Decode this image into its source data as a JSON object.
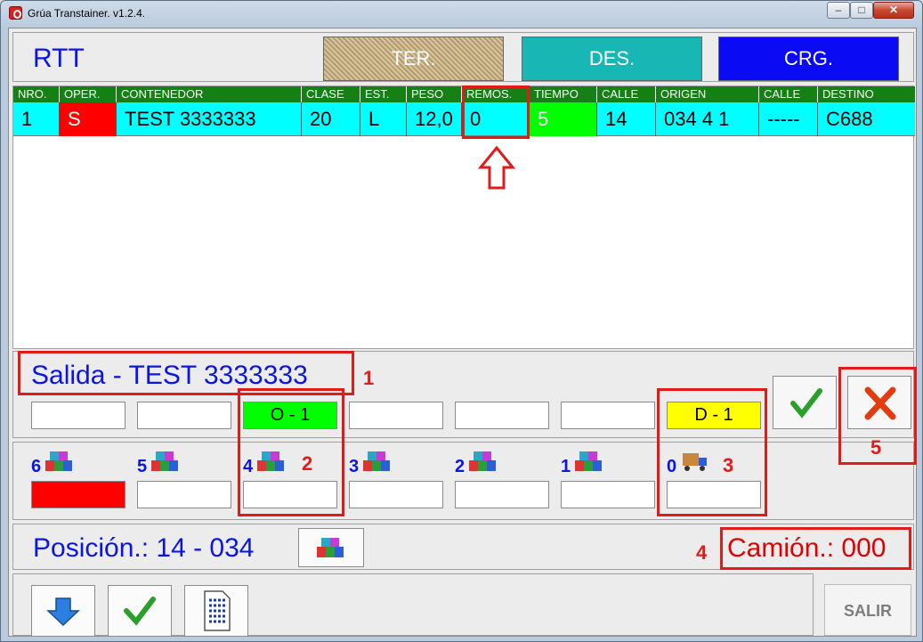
{
  "window": {
    "title": "Grúa Transtainer. v1.2.4.",
    "minimize": "–",
    "maximize": "□",
    "close": "✕"
  },
  "header": {
    "rtt": "RTT",
    "modes": [
      "TER.",
      "DES.",
      "CRG."
    ]
  },
  "grid": {
    "columns": [
      "NRO.",
      "OPER.",
      "CONTENEDOR",
      "CLASE",
      "EST.",
      "PESO",
      "REMOS.",
      "TIEMPO",
      "CALLE",
      "ORIGEN",
      "CALLE",
      "DESTINO"
    ],
    "row": [
      "1",
      "S",
      "TEST 3333333",
      "20",
      "L",
      "12,0",
      "0",
      "5",
      "14",
      "034 4 1",
      "-----",
      "C688"
    ]
  },
  "op": {
    "title": "Salida - TEST 3333333",
    "slots": [
      "",
      "",
      "O - 1",
      "",
      "",
      "",
      "D - 1"
    ]
  },
  "levels": [
    "6",
    "5",
    "4",
    "3",
    "2",
    "1",
    "0"
  ],
  "position": {
    "label": "Posición.: 14 - 034",
    "camion": "Camión.: 000"
  },
  "footer": {
    "salir": "SALIR"
  },
  "annotations": [
    "1",
    "2",
    "3",
    "4",
    "5"
  ],
  "colors": {
    "blue_text": "#0a14e6",
    "origin_slot": "#00ff00",
    "dest_slot": "#ffff00",
    "grid_header": "#167f16",
    "row_bg": "#00ffff",
    "annotation_red": "#e11a1a"
  }
}
